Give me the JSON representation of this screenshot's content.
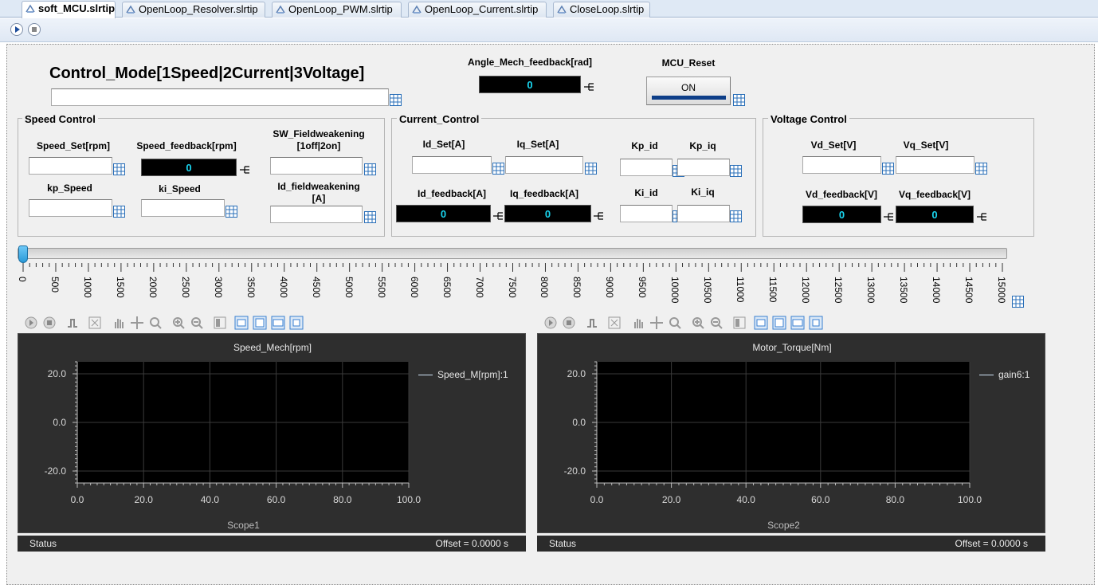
{
  "tabs": [
    {
      "label": "soft_MCU.slrtip",
      "active": true
    },
    {
      "label": "OpenLoop_Resolver.slrtip",
      "active": false
    },
    {
      "label": "OpenLoop_PWM.slrtip",
      "active": false
    },
    {
      "label": "OpenLoop_Current.slrtip",
      "active": false
    },
    {
      "label": "CloseLoop.slrtip",
      "active": false
    }
  ],
  "header": {
    "control_mode_label": "Control_Mode[1Speed|2Current|3Voltage]",
    "control_mode_value": "",
    "angle_label": "Angle_Mech_feedback[rad]",
    "angle_value": "0",
    "mcu_reset_label": "MCU_Reset",
    "mcu_reset_button": "ON"
  },
  "speed_control": {
    "title": "Speed Control",
    "speed_set_label": "Speed_Set[rpm]",
    "speed_set_value": "",
    "speed_feedback_label": "Speed_feedback[rpm]",
    "speed_feedback_value": "0",
    "sw_fw_label_line1": "SW_Fieldweakening",
    "sw_fw_label_line2": "[1off|2on]",
    "sw_fw_value": "",
    "kp_label": "kp_Speed",
    "kp_value": "",
    "ki_label": "ki_Speed",
    "ki_value": "",
    "id_fw_label_line1": "Id_fieldweakening",
    "id_fw_label_line2": "[A]",
    "id_fw_value": ""
  },
  "current_control": {
    "title": "Current_Control",
    "id_set_label": "Id_Set[A]",
    "iq_set_label": "Iq_Set[A]",
    "kp_id_label": "Kp_id",
    "kp_iq_label": "Kp_iq",
    "id_fb_label": "Id_feedback[A]",
    "id_fb_value": "0",
    "iq_fb_label": "Iq_feedback[A]",
    "iq_fb_value": "0",
    "ki_id_label": "Ki_id",
    "ki_iq_label": "Ki_iq"
  },
  "voltage_control": {
    "title": "Voltage Control",
    "vd_set_label": "Vd_Set[V]",
    "vq_set_label": "Vq_Set[V]",
    "vd_fb_label": "Vd_feedback[V]",
    "vd_fb_value": "0",
    "vq_fb_label": "Vq_feedback[V]",
    "vq_fb_value": "0"
  },
  "slider": {
    "value": 0,
    "min": 0,
    "max": 15000,
    "ticks": [
      "0",
      "500",
      "1000",
      "1500",
      "2000",
      "2500",
      "3000",
      "3500",
      "4000",
      "4500",
      "5000",
      "5500",
      "6000",
      "6500",
      "7000",
      "7500",
      "8000",
      "8500",
      "9000",
      "9500",
      "10000",
      "10500",
      "11000",
      "11500",
      "12000",
      "12500",
      "13000",
      "13500",
      "14000",
      "14500",
      "15000"
    ]
  },
  "scopes": [
    {
      "title": "Speed_Mech[rpm]",
      "legend": "Speed_M[rpm]:1",
      "name": "Scope1",
      "status": "Status",
      "offset": "Offset = 0.0000 s",
      "yticks": [
        "20.0",
        "0.0",
        "-20.0"
      ],
      "xticks": [
        "0.0",
        "20.0",
        "40.0",
        "60.0",
        "80.0",
        "100.0"
      ]
    },
    {
      "title": "Motor_Torque[Nm]",
      "legend": "gain6:1",
      "name": "Scope2",
      "status": "Status",
      "offset": "Offset = 0.0000 s",
      "yticks": [
        "20.0",
        "0.0",
        "-20.0"
      ],
      "xticks": [
        "0.0",
        "20.0",
        "40.0",
        "60.0",
        "80.0",
        "100.0"
      ]
    }
  ],
  "colors": {
    "display_bg": "#000000",
    "display_text": "#19d6f0",
    "button_bar": "#0d3e88",
    "scope_bg": "#2e2e2e"
  }
}
